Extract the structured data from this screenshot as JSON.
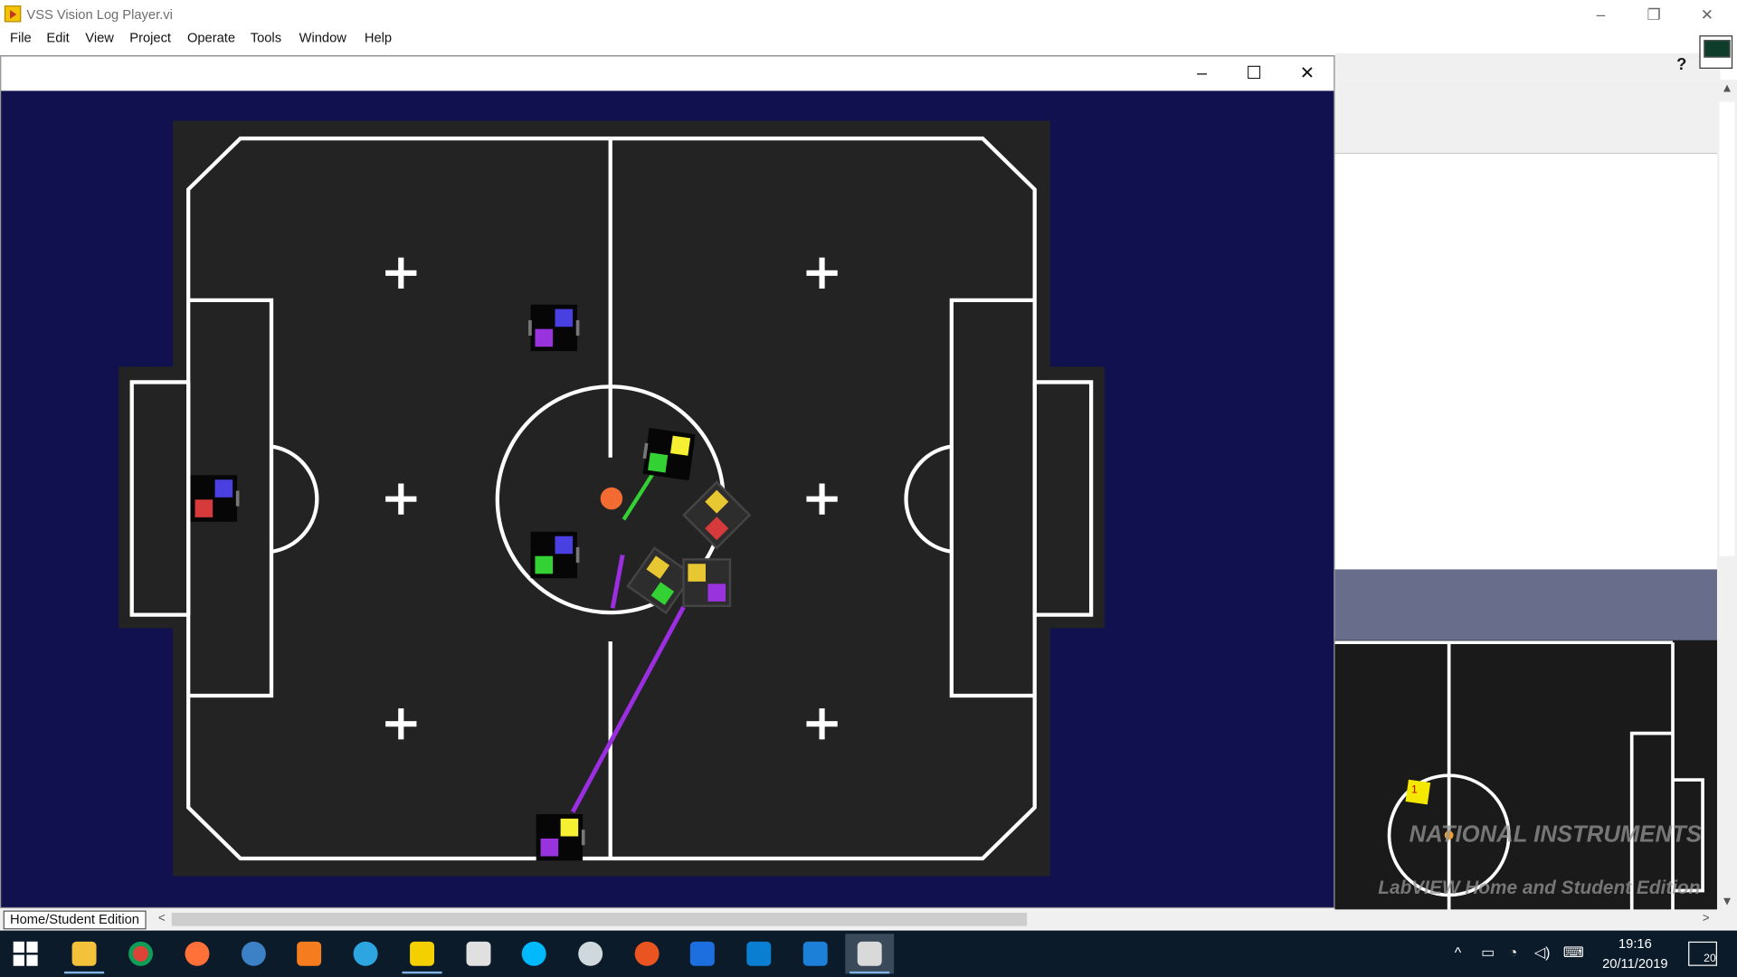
{
  "window": {
    "title": "VSS Vision Log Player.vi",
    "minimize_glyph": "–",
    "restore_glyph": "❐",
    "close_glyph": "✕"
  },
  "menu": {
    "items": [
      "File",
      "Edit",
      "View",
      "Project",
      "Operate",
      "Tools",
      "Window",
      "Help"
    ]
  },
  "toolbar": {
    "help_glyph": "?"
  },
  "child_window": {
    "minimize_glyph": "–",
    "maximize_glyph": "☐",
    "close_glyph": "✕"
  },
  "field": {
    "background": "#232323",
    "line_color": "#ffffff",
    "ball_color": "#f26b33",
    "robots": [
      {
        "team_color": "#4a3fe0",
        "id_color": "#9933dd"
      },
      {
        "team_color": "#4a3fe0",
        "id_color": "#d63a3a"
      },
      {
        "team_color": "#f5f032",
        "id_color": "#33d133"
      },
      {
        "team_color": "#4a3fe0",
        "id_color": "#33d133"
      },
      {
        "team_color": "#e8c832",
        "id_color": "#d63a3a"
      },
      {
        "team_color": "#e8c832",
        "id_color": "#33d133"
      },
      {
        "team_color": "#e8c832",
        "id_color": "#9933dd"
      },
      {
        "team_color": "#f5f032",
        "id_color": "#9933dd"
      }
    ]
  },
  "mini_field": {
    "robot_label": "1",
    "watermark_line1": "NATIONAL INSTRUMENTS",
    "watermark_line2": "LabVIEW Home and Student Edition"
  },
  "status": {
    "edition": "Home/Student Edition",
    "scroll_left": "<",
    "scroll_right": ">"
  },
  "scrollbar": {
    "up": "▲",
    "down": "▼"
  },
  "taskbar": {
    "apps": [
      "file-explorer",
      "chrome",
      "firefox",
      "qbittorrent",
      "office",
      "telegram",
      "labview",
      "video-editor",
      "logitech",
      "paint",
      "ubuntu",
      "malwarebytes",
      "vscode",
      "wireshark",
      "labview-active"
    ],
    "tray_arrow": "^",
    "battery_glyph": "▭",
    "wifi_glyph": "◔",
    "volume_glyph": "◁)",
    "keyboard_glyph": "⌨",
    "time": "19:16",
    "date": "20/11/2019",
    "notifications": "20"
  }
}
